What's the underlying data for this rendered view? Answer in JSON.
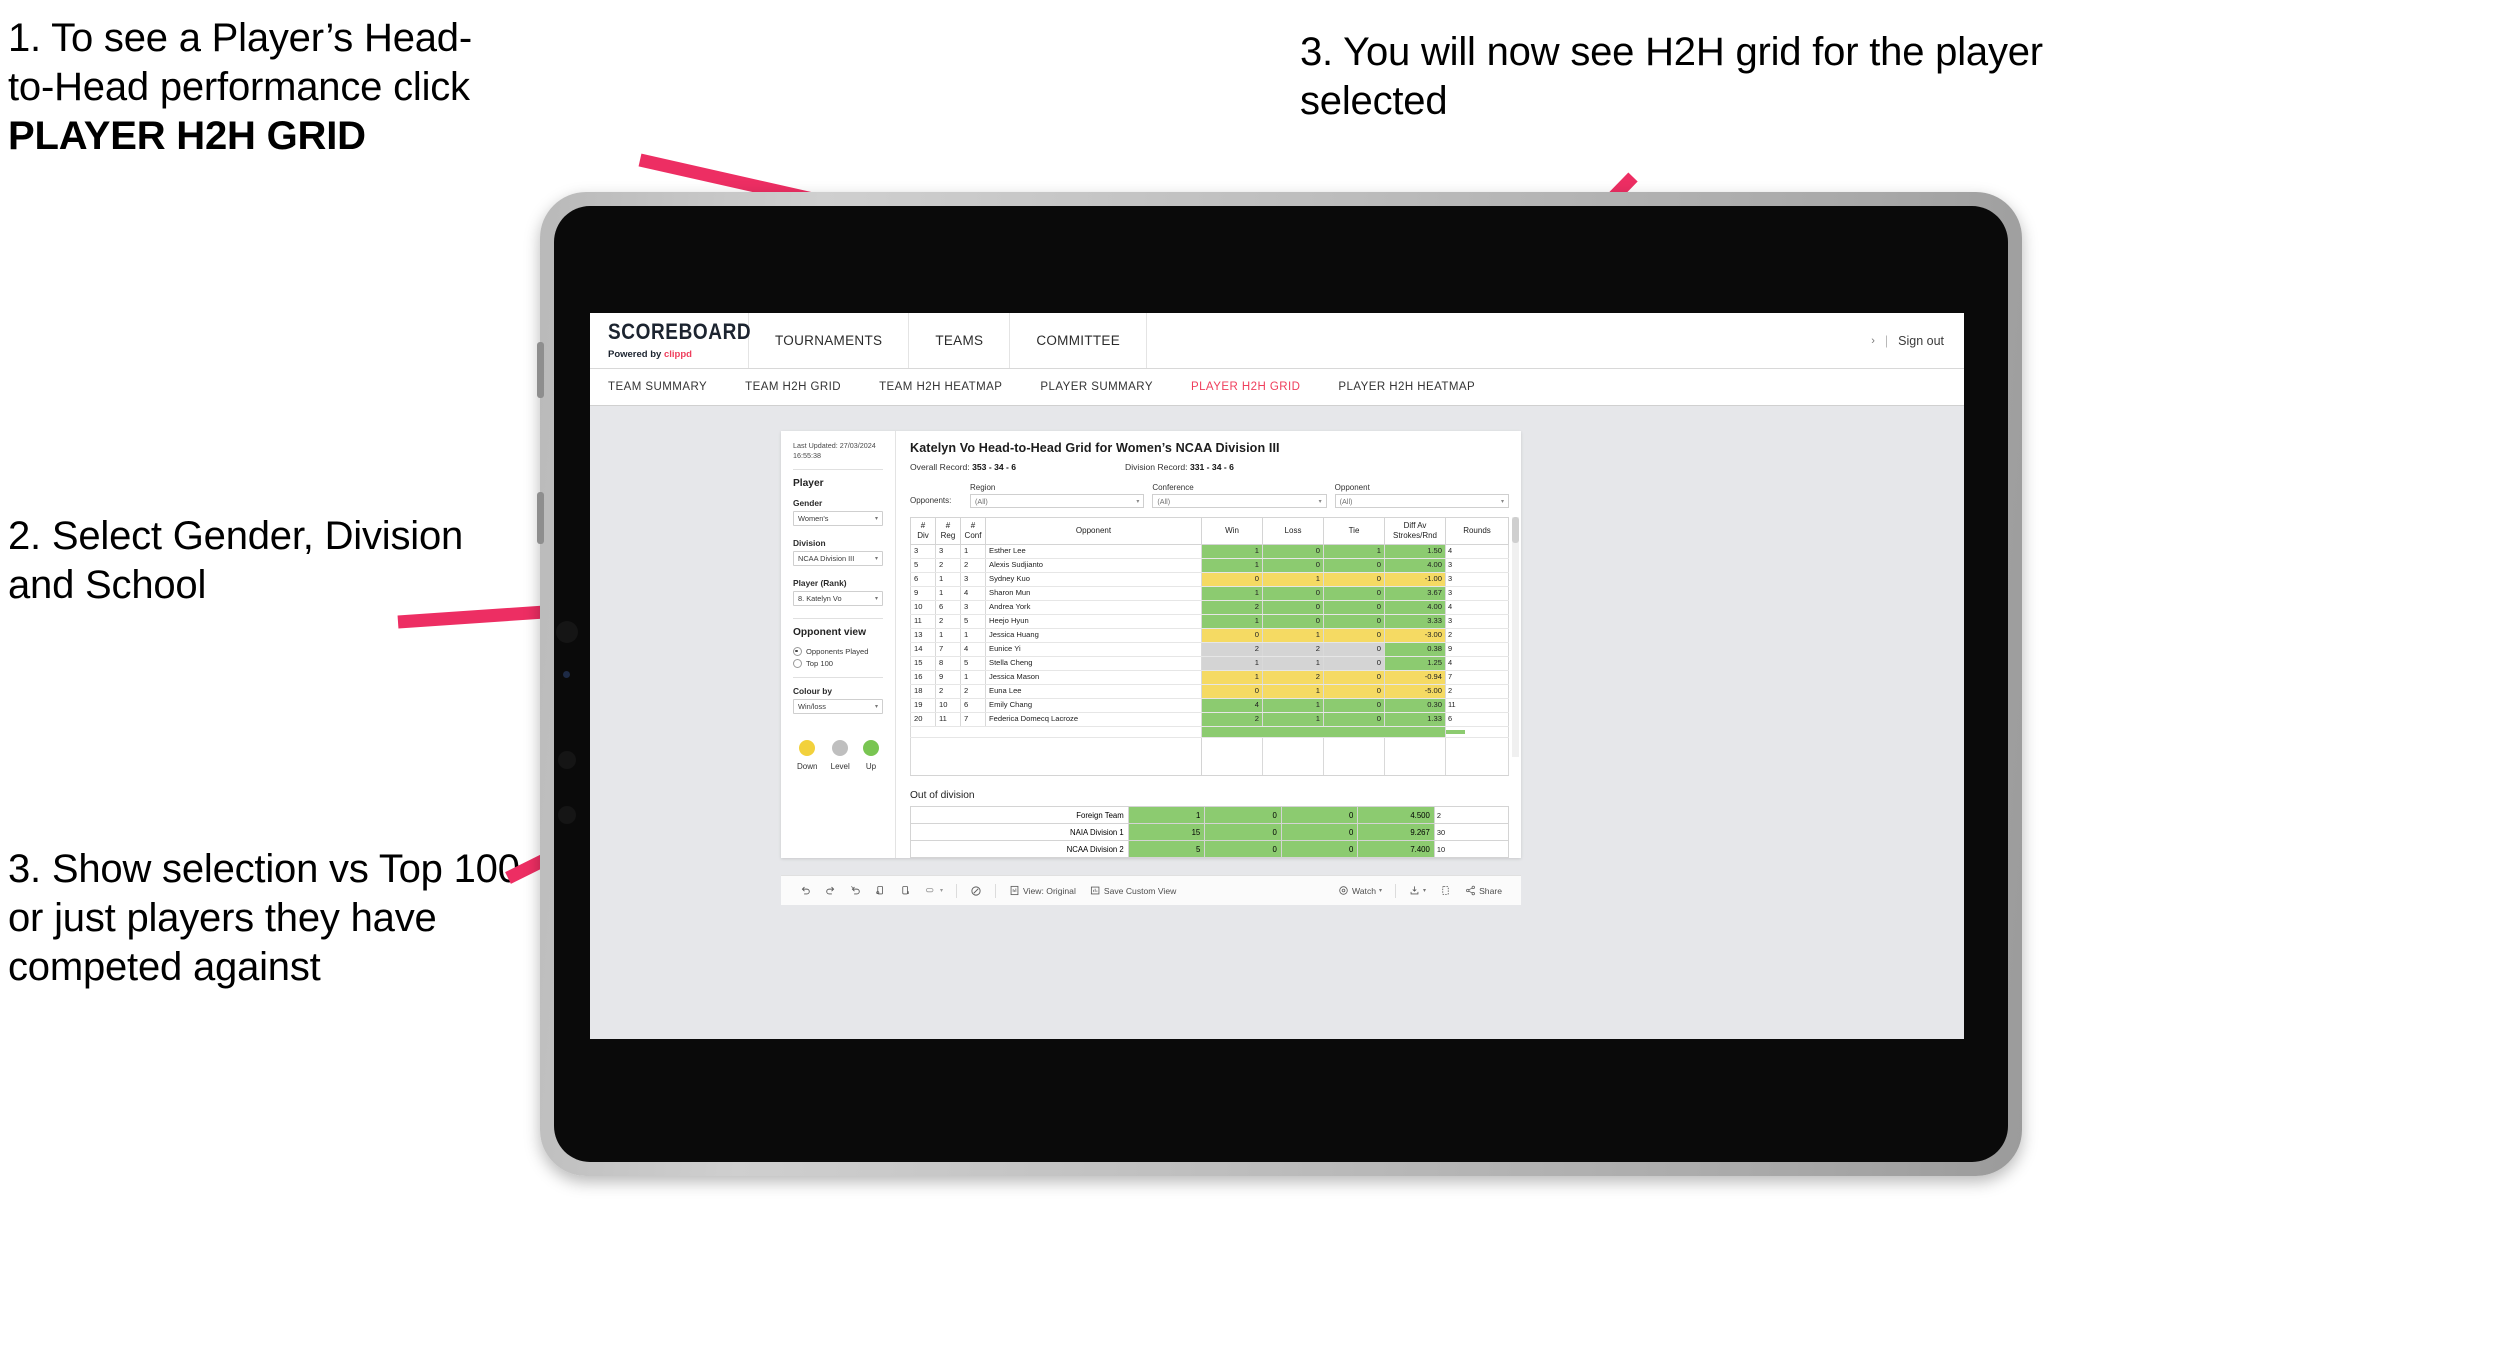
{
  "annotations": {
    "a1_line1": "1. To see a Player’s Head-",
    "a1_line2": "to-Head performance click",
    "a1_bold": "PLAYER H2H GRID",
    "a2": "3. You will now see H2H grid for the player selected",
    "a3": "2. Select Gender, Division and School",
    "a4": "3. Show selection vs Top 100 or just players they have competed against",
    "arrow_color": "#ED2E63"
  },
  "appbar": {
    "brand_title": "SCOREBOARD",
    "brand_sub_prefix": "Powered by ",
    "brand_sub_accent": "clippd",
    "nav": [
      "TOURNAMENTS",
      "TEAMS",
      "COMMITTEE"
    ],
    "account_chevron": "›",
    "divider": "|",
    "sign_out": "Sign out"
  },
  "tabs": [
    {
      "label": "TEAM SUMMARY",
      "active": false
    },
    {
      "label": "TEAM H2H GRID",
      "active": false
    },
    {
      "label": "TEAM H2H HEATMAP",
      "active": false
    },
    {
      "label": "PLAYER SUMMARY",
      "active": false
    },
    {
      "label": "PLAYER H2H GRID",
      "active": true
    },
    {
      "label": "PLAYER H2H HEATMAP",
      "active": false
    }
  ],
  "sidebar": {
    "last_updated": "Last Updated: 27/03/2024 16:55:38",
    "section_player": "Player",
    "gender_label": "Gender",
    "gender_value": "Women's",
    "division_label": "Division",
    "division_value": "NCAA Division III",
    "player_label": "Player (Rank)",
    "player_value": "8. Katelyn Vo",
    "opponent_view_label": "Opponent view",
    "opt_opponents_played": "Opponents Played",
    "opt_top100": "Top 100",
    "selected_opponent_view": "Opponents Played",
    "colour_by_label": "Colour by",
    "colour_by_value": "Win/loss",
    "legend": [
      {
        "label": "Down",
        "color": "#F2D13C"
      },
      {
        "label": "Level",
        "color": "#BFBFBF"
      },
      {
        "label": "Up",
        "color": "#79C552"
      }
    ]
  },
  "main": {
    "title": "Katelyn Vo Head-to-Head Grid for Women’s NCAA Division III",
    "overall_record_label": "Overall Record: ",
    "overall_record_value": "353 - 34 - 6",
    "division_record_label": "Division Record: ",
    "division_record_value": "331 - 34 - 6",
    "opponents_label": "Opponents:",
    "filters": [
      {
        "label": "Region",
        "value": "(All)"
      },
      {
        "label": "Conference",
        "value": "(All)"
      },
      {
        "label": "Opponent",
        "value": "(All)"
      }
    ],
    "out_of_division_title": "Out of division"
  },
  "chart_data": {
    "type": "table",
    "title": "Katelyn Vo Head-to-Head Grid for Women’s NCAA Division III",
    "columns": [
      "# Div",
      "# Reg",
      "# Conf",
      "Opponent",
      "Win",
      "Loss",
      "Tie",
      "Diff Av Strokes/Rnd",
      "Rounds"
    ],
    "rows": [
      {
        "div": "3",
        "reg": "3",
        "conf": "1",
        "opponent": "Esther Lee",
        "win": "1",
        "loss": "0",
        "tie": "1",
        "diff": "1.50",
        "rounds": "4",
        "status": "up"
      },
      {
        "div": "5",
        "reg": "2",
        "conf": "2",
        "opponent": "Alexis Sudjianto",
        "win": "1",
        "loss": "0",
        "tie": "0",
        "diff": "4.00",
        "rounds": "3",
        "status": "up"
      },
      {
        "div": "6",
        "reg": "1",
        "conf": "3",
        "opponent": "Sydney Kuo",
        "win": "0",
        "loss": "1",
        "tie": "0",
        "diff": "-1.00",
        "rounds": "3",
        "status": "down"
      },
      {
        "div": "9",
        "reg": "1",
        "conf": "4",
        "opponent": "Sharon Mun",
        "win": "1",
        "loss": "0",
        "tie": "0",
        "diff": "3.67",
        "rounds": "3",
        "status": "up"
      },
      {
        "div": "10",
        "reg": "6",
        "conf": "3",
        "opponent": "Andrea York",
        "win": "2",
        "loss": "0",
        "tie": "0",
        "diff": "4.00",
        "rounds": "4",
        "status": "up"
      },
      {
        "div": "11",
        "reg": "2",
        "conf": "5",
        "opponent": "Heejo Hyun",
        "win": "1",
        "loss": "0",
        "tie": "0",
        "diff": "3.33",
        "rounds": "3",
        "status": "up"
      },
      {
        "div": "13",
        "reg": "1",
        "conf": "1",
        "opponent": "Jessica Huang",
        "win": "0",
        "loss": "1",
        "tie": "0",
        "diff": "-3.00",
        "rounds": "2",
        "status": "down"
      },
      {
        "div": "14",
        "reg": "7",
        "conf": "4",
        "opponent": "Eunice Yi",
        "win": "2",
        "loss": "2",
        "tie": "0",
        "diff": "0.38",
        "rounds": "9",
        "status": "level",
        "diff_status": "up"
      },
      {
        "div": "15",
        "reg": "8",
        "conf": "5",
        "opponent": "Stella Cheng",
        "win": "1",
        "loss": "1",
        "tie": "0",
        "diff": "1.25",
        "rounds": "4",
        "status": "level",
        "diff_status": "up"
      },
      {
        "div": "16",
        "reg": "9",
        "conf": "1",
        "opponent": "Jessica Mason",
        "win": "1",
        "loss": "2",
        "tie": "0",
        "diff": "-0.94",
        "rounds": "7",
        "status": "down"
      },
      {
        "div": "18",
        "reg": "2",
        "conf": "2",
        "opponent": "Euna Lee",
        "win": "0",
        "loss": "1",
        "tie": "0",
        "diff": "-5.00",
        "rounds": "2",
        "status": "down"
      },
      {
        "div": "19",
        "reg": "10",
        "conf": "6",
        "opponent": "Emily Chang",
        "win": "4",
        "loss": "1",
        "tie": "0",
        "diff": "0.30",
        "rounds": "11",
        "status": "up"
      },
      {
        "div": "20",
        "reg": "11",
        "conf": "7",
        "opponent": "Federica Domecq Lacroze",
        "win": "2",
        "loss": "1",
        "tie": "0",
        "diff": "1.33",
        "rounds": "6",
        "status": "up"
      }
    ],
    "out_of_division": [
      {
        "label": "Foreign Team",
        "win": "1",
        "loss": "0",
        "tie": "0",
        "diff": "4.500",
        "rounds": "2",
        "status": "up"
      },
      {
        "label": "NAIA Division 1",
        "win": "15",
        "loss": "0",
        "tie": "0",
        "diff": "9.267",
        "rounds": "30",
        "status": "up"
      },
      {
        "label": "NCAA Division 2",
        "win": "5",
        "loss": "0",
        "tie": "0",
        "diff": "7.400",
        "rounds": "10",
        "status": "up"
      }
    ],
    "colors": {
      "up": "#8CCB70",
      "down": "#F5DA63",
      "level": "#D4D4D4"
    },
    "max_rounds": 11,
    "max_rounds_ood": 30
  },
  "toolbar": {
    "view_original": "View: Original",
    "save_custom_view": "Save Custom View",
    "watch": "Watch",
    "share": "Share",
    "caret": "▾"
  }
}
